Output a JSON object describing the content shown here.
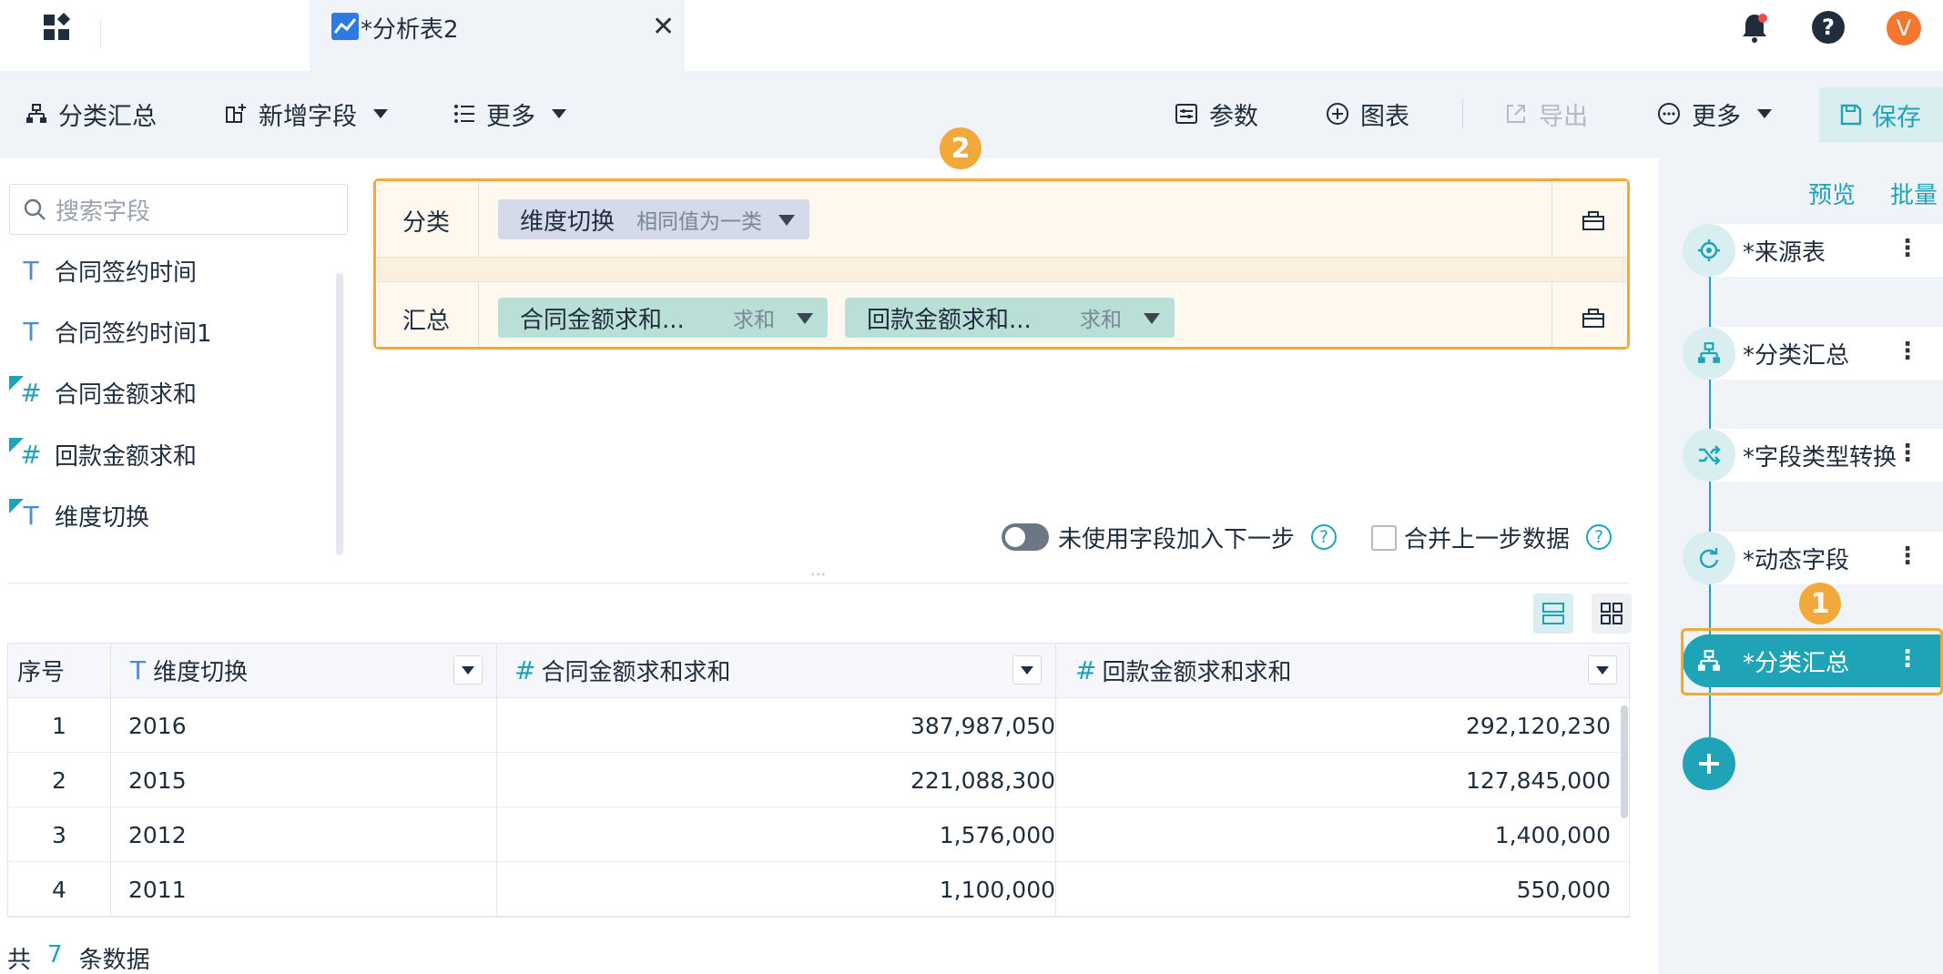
{
  "tab": {
    "title": "*分析表2"
  },
  "toolbar": {
    "group_summary": "分类汇总",
    "add_field": "新增字段",
    "more_left": "更多",
    "params": "参数",
    "chart": "图表",
    "export": "导出",
    "more_right": "更多",
    "save": "保存"
  },
  "header_icons": {
    "notifications": "bell-icon",
    "help": "?",
    "avatar_letter": "V"
  },
  "step_badges": {
    "one": "1",
    "two": "2"
  },
  "left_panel": {
    "search_placeholder": "搜索字段",
    "fields": [
      {
        "type": "T",
        "label": "合同签约时间",
        "calc": false
      },
      {
        "type": "T",
        "label": "合同签约时间1",
        "calc": false
      },
      {
        "type": "#",
        "label": "合同金额求和",
        "calc": true
      },
      {
        "type": "#",
        "label": "回款金额求和",
        "calc": true
      },
      {
        "type": "T",
        "label": "维度切换",
        "calc": true
      }
    ]
  },
  "config": {
    "group_label": "分类",
    "summary_label": "汇总",
    "group_chip": {
      "name": "维度切换",
      "mode": "相同值为一类"
    },
    "summary_chips": [
      {
        "name": "合同金额求和...",
        "agg": "求和"
      },
      {
        "name": "回款金额求和...",
        "agg": "求和"
      }
    ]
  },
  "options": {
    "unused_fields_label": "未使用字段加入下一步",
    "merge_label": "合并上一步数据",
    "help": "?",
    "drag_handle": "..."
  },
  "table": {
    "headers": [
      "序号",
      "维度切换",
      "合同金额求和求和",
      "回款金额求和求和"
    ],
    "rows": [
      [
        "1",
        "2016",
        "387,987,050",
        "292,120,230"
      ],
      [
        "2",
        "2015",
        "221,088,300",
        "127,845,000"
      ],
      [
        "3",
        "2012",
        "1,576,000",
        "1,400,000"
      ],
      [
        "4",
        "2011",
        "1,100,000",
        "550,000"
      ]
    ]
  },
  "footer": {
    "prefix": "共",
    "count": "7",
    "suffix": "条数据"
  },
  "right_panel": {
    "preview": "预览",
    "batch": "批量",
    "steps": [
      {
        "label": "*来源表",
        "icon": "target-icon",
        "active": false
      },
      {
        "label": "*分类汇总",
        "icon": "hierarchy-icon",
        "active": false
      },
      {
        "label": "*字段类型转换",
        "icon": "shuffle-icon",
        "active": false
      },
      {
        "label": "*动态字段",
        "icon": "refresh-icon",
        "active": false
      },
      {
        "label": "*分类汇总",
        "icon": "hierarchy-icon",
        "active": true
      }
    ],
    "step_menu": "⋮",
    "add": "+"
  },
  "colors": {
    "accent": "#1fa3b6",
    "highlight": "#f2a93b",
    "avatar": "#f5762e",
    "dimension_chip": "#d4dae9",
    "metric_chip": "#b9dfd6"
  }
}
